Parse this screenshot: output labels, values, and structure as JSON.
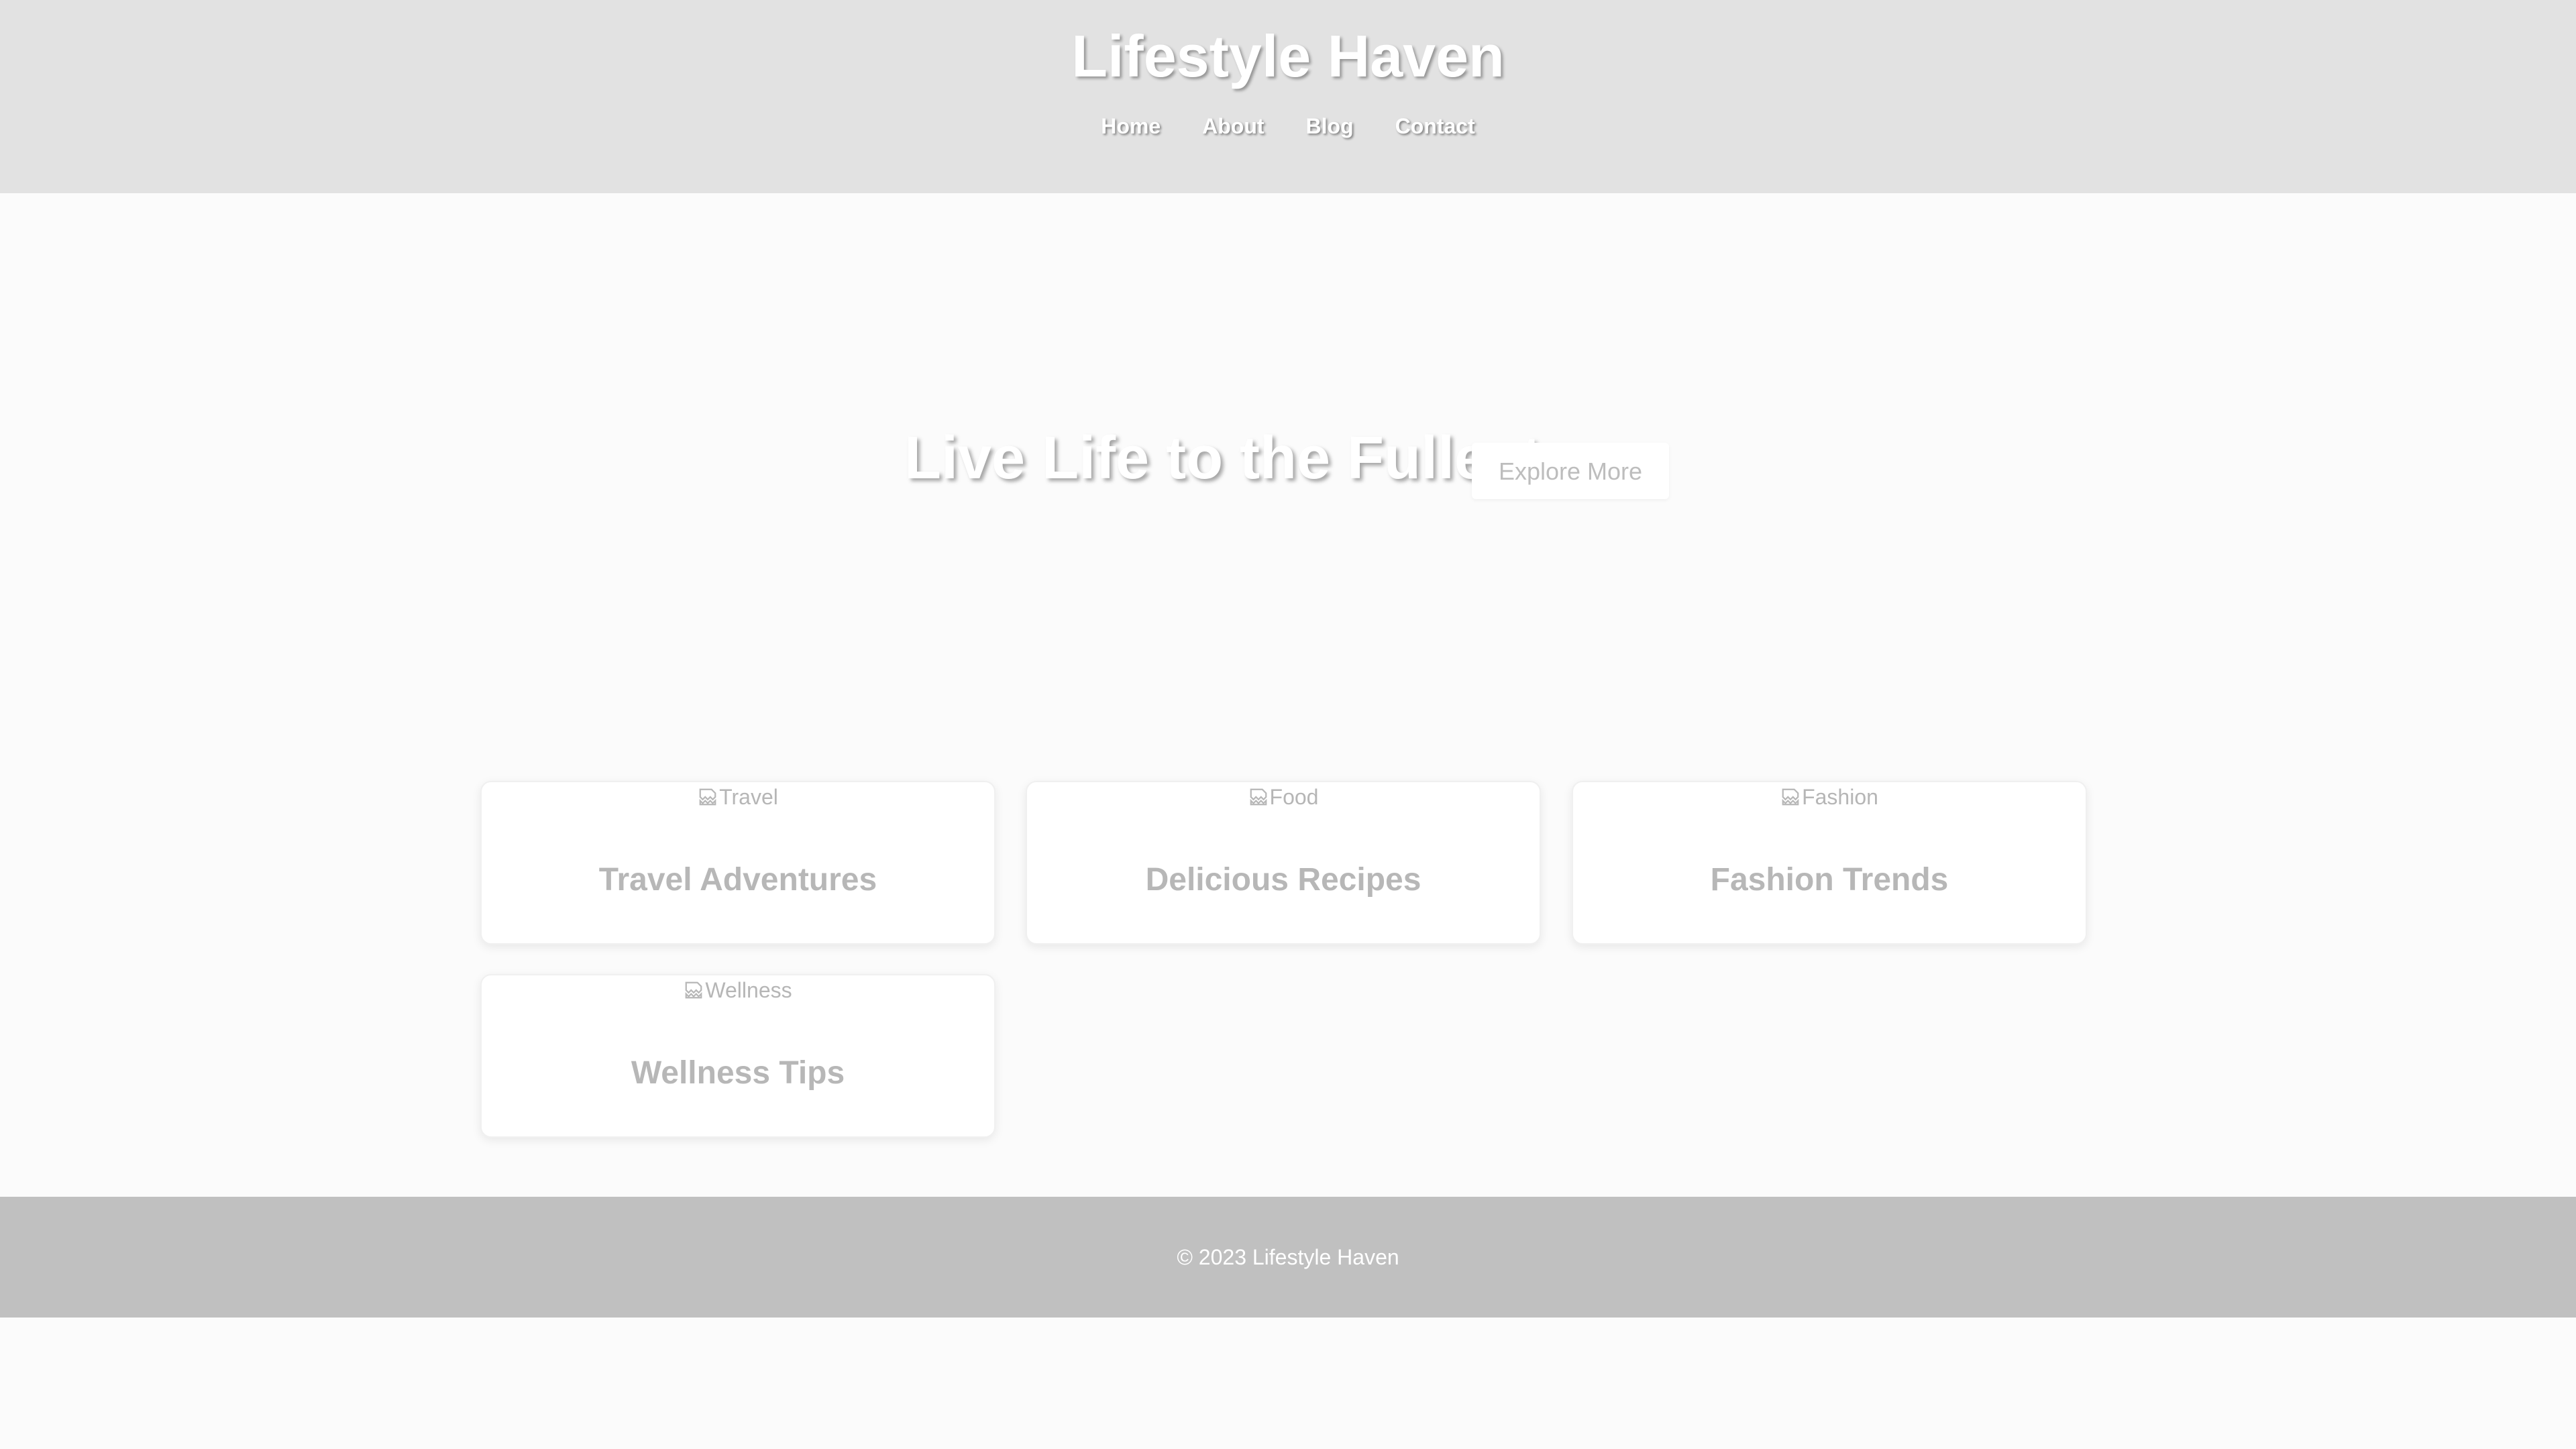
{
  "header": {
    "title": "Lifestyle Haven",
    "nav": [
      {
        "label": "Home"
      },
      {
        "label": "About"
      },
      {
        "label": "Blog"
      },
      {
        "label": "Contact"
      }
    ]
  },
  "hero": {
    "title": "Live Life to the Fullest",
    "button_label": "Explore More"
  },
  "cards": [
    {
      "image_alt": "Travel",
      "title": "Travel Adventures",
      "icon": "broken-image-icon"
    },
    {
      "image_alt": "Food",
      "title": "Delicious Recipes",
      "icon": "broken-image-icon"
    },
    {
      "image_alt": "Fashion",
      "title": "Fashion Trends",
      "icon": "broken-image-icon"
    },
    {
      "image_alt": "Wellness",
      "title": "Wellness Tips",
      "icon": "broken-image-icon"
    }
  ],
  "footer": {
    "text": "© 2023 Lifestyle Haven"
  },
  "colors": {
    "header_bg": "#e2e2e2",
    "footer_bg": "#c0c0c0",
    "page_bg": "#fbfbfb",
    "card_bg": "#ffffff"
  }
}
